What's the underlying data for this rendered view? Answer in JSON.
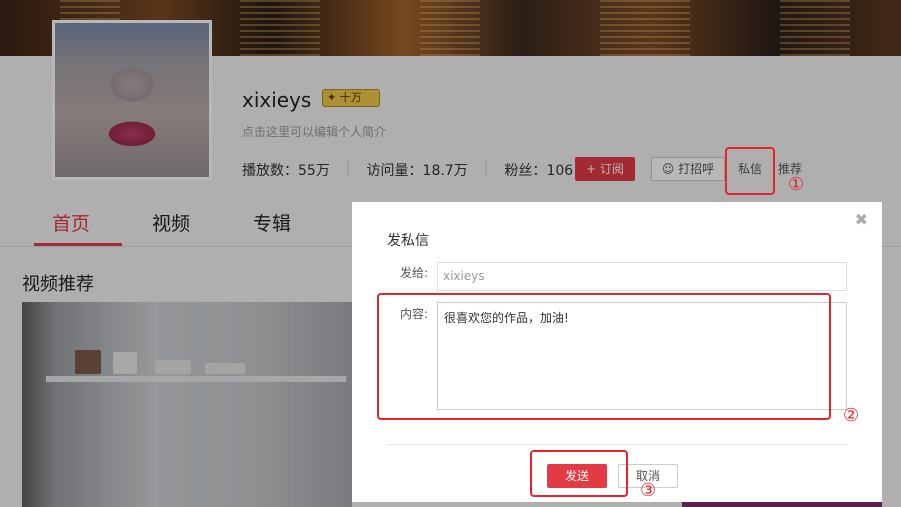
{
  "profile": {
    "username": "xixieys",
    "badge_label": "十万",
    "bio_placeholder": "点击这里可以编辑个人简介",
    "stats": [
      {
        "label": "播放数：",
        "value": "55万"
      },
      {
        "label": "访问量：",
        "value": "18.7万"
      },
      {
        "label": "粉丝：",
        "value": "106"
      }
    ],
    "subscribe_label": "+ 订阅",
    "greet_label": "打招呼",
    "private_message_label": "私信",
    "recommend_label": "推荐"
  },
  "tabs": [
    "首页",
    "视频",
    "专辑"
  ],
  "section_title": "视频推荐",
  "dialog": {
    "title": "发私信",
    "to_label": "发给:",
    "to_value": "xixieys",
    "content_label": "内容:",
    "content_value": "很喜欢您的作品，加油!",
    "send_label": "发送",
    "cancel_label": "取消",
    "close_symbol": "✖"
  },
  "annotations": [
    "①",
    "②",
    "③"
  ],
  "colors": {
    "accent": "#e23b43",
    "highlight": "#e1262e"
  },
  "icons": [
    "smile-icon",
    "close-icon"
  ]
}
